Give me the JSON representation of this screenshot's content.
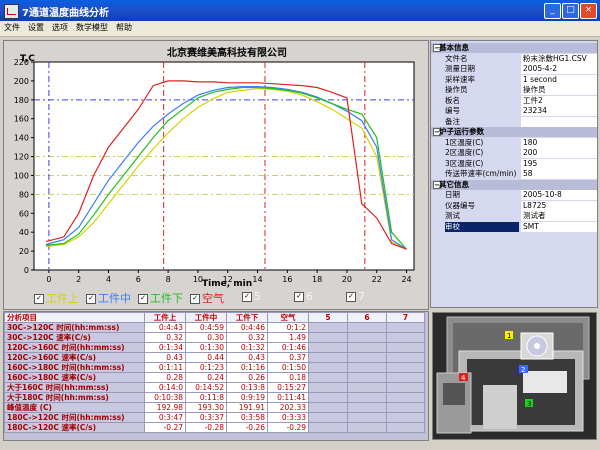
{
  "window": {
    "title": "7通道温度曲线分析"
  },
  "menu": [
    "文件",
    "设置",
    "选项",
    "数学模型",
    "帮助"
  ],
  "chart": {
    "title": "北京赛维美高科技有限公司",
    "ylabel": "T,C",
    "xlabel": "Time, min",
    "xticks": [
      "0",
      "2",
      "4",
      "6",
      "8",
      "10",
      "12",
      "14",
      "16",
      "18",
      "20",
      "22",
      "24"
    ],
    "yticks": [
      "0",
      "20",
      "40",
      "60",
      "80",
      "100",
      "120",
      "140",
      "160",
      "180",
      "200",
      "220"
    ]
  },
  "chart_data": {
    "type": "line",
    "title": "北京赛维美高科技有限公司",
    "xlabel": "Time, min",
    "ylabel": "T,C",
    "xlim": [
      -1,
      24.5
    ],
    "ylim": [
      0,
      220
    ],
    "grid": false,
    "reference_lines": {
      "horizontal": [
        80,
        100,
        120,
        180
      ],
      "vertical": [
        0,
        7.7,
        14.5,
        21.2
      ]
    },
    "series": [
      {
        "name": "工件上",
        "color": "#d4d400",
        "x": [
          -0.2,
          1,
          2,
          3,
          4,
          5,
          6,
          7,
          8,
          9,
          10,
          11,
          12,
          13,
          14,
          15,
          16,
          17,
          18,
          19,
          20,
          21,
          22,
          23,
          24
        ],
        "y": [
          25,
          27,
          35,
          50,
          70,
          90,
          110,
          128,
          145,
          160,
          172,
          181,
          188,
          190,
          192,
          191,
          189,
          185,
          178,
          170,
          160,
          150,
          120,
          30,
          22
        ]
      },
      {
        "name": "工件中",
        "color": "#3c7cff",
        "x": [
          -0.2,
          1,
          2,
          3,
          4,
          5,
          6,
          7,
          8,
          9,
          10,
          11,
          12,
          13,
          14,
          15,
          16,
          17,
          18,
          19,
          20,
          21,
          22,
          23,
          24
        ],
        "y": [
          27,
          32,
          45,
          70,
          95,
          115,
          135,
          152,
          165,
          176,
          185,
          190,
          193,
          194,
          194,
          193,
          191,
          188,
          183,
          176,
          168,
          158,
          130,
          32,
          22
        ]
      },
      {
        "name": "工件下",
        "color": "#20c020",
        "x": [
          -0.2,
          1,
          2,
          3,
          4,
          5,
          6,
          7,
          8,
          9,
          10,
          11,
          12,
          13,
          14,
          15,
          16,
          17,
          18,
          19,
          20,
          21,
          22,
          23,
          24
        ],
        "y": [
          26,
          28,
          38,
          58,
          80,
          100,
          120,
          140,
          158,
          170,
          182,
          188,
          191,
          193,
          193,
          192,
          190,
          187,
          182,
          176,
          170,
          165,
          140,
          40,
          22
        ]
      },
      {
        "name": "空气",
        "color": "#e02020",
        "x": [
          -0.2,
          1,
          2,
          3,
          4,
          5,
          6,
          7,
          8,
          9,
          10,
          11,
          12,
          13,
          14,
          15,
          16,
          17,
          18,
          19,
          20,
          21,
          22,
          23,
          24
        ],
        "y": [
          30,
          35,
          60,
          100,
          130,
          150,
          170,
          195,
          200,
          200,
          199,
          199,
          198,
          198,
          198,
          197,
          196,
          195,
          193,
          188,
          182,
          70,
          55,
          28,
          22
        ]
      }
    ],
    "inactive_series": [
      "5",
      "6",
      "7"
    ]
  },
  "table": {
    "headers": [
      "分析项目",
      "工件上",
      "工件中",
      "工件下",
      "空气",
      "5",
      "6",
      "7"
    ],
    "rows": [
      {
        "label": "30C->120C 时间(hh:mm:ss)",
        "values": [
          "0:4:43",
          "0:4:59",
          "0:4:46",
          "0:1:2"
        ]
      },
      {
        "label": "30C->120C 速率(C/s)",
        "values": [
          "0.32",
          "0.30",
          "0.32",
          "1.49"
        ]
      },
      {
        "label": "120C->160C 时间(hh:mm:ss)",
        "values": [
          "0:1:34",
          "0:1:30",
          "0:1:32",
          "0:1:46"
        ]
      },
      {
        "label": "120C->160C 速率(C/s)",
        "values": [
          "0.43",
          "0.44",
          "0.43",
          "0.37"
        ]
      },
      {
        "label": "160C->180C 时间(hh:mm:ss)",
        "values": [
          "0:1:11",
          "0:1:23",
          "0:1:16",
          "0:1:50"
        ]
      },
      {
        "label": "160C->180C 速率(C/s)",
        "values": [
          "0.28",
          "0.24",
          "0.26",
          "0.18"
        ]
      },
      {
        "label": "大于160C 时间(hh:mm:ss)",
        "values": [
          "0:14:0",
          "0:14:52",
          "0:13:8",
          "0:15:27"
        ]
      },
      {
        "label": "大于180C 时间(hh:mm:ss)",
        "values": [
          "0:10:38",
          "0:11:8",
          "0:9:19",
          "0:11:41"
        ]
      },
      {
        "label": "峰值温度 (C)",
        "values": [
          "192.98",
          "193.30",
          "191.91",
          "202.33"
        ]
      },
      {
        "label": "180C->120C 时间(hh:mm:ss)",
        "values": [
          "0:3:47",
          "0:3:37",
          "0:3:58",
          "0:3:33"
        ]
      },
      {
        "label": "180C->120C 速率(C/s)",
        "values": [
          "-0.27",
          "-0.28",
          "-0.26",
          "-0.29"
        ]
      }
    ]
  },
  "props": [
    {
      "category": "基本信息"
    },
    {
      "k": "文件名",
      "v": "粉末涂敷HG1.CSV"
    },
    {
      "k": "测量日期",
      "v": "2005-4-2"
    },
    {
      "k": "采样速率",
      "v": "1 second"
    },
    {
      "k": "操作员",
      "v": "操作员"
    },
    {
      "k": "板名",
      "v": "工件2"
    },
    {
      "k": "编号",
      "v": "23234"
    },
    {
      "k": "备注",
      "v": ""
    },
    {
      "category": "炉子运行参数"
    },
    {
      "k": "1区温度(C)",
      "v": "180"
    },
    {
      "k": "2区温度(C)",
      "v": "200"
    },
    {
      "k": "3区温度(C)",
      "v": "195"
    },
    {
      "k": "传送带速率(cm/min)",
      "v": "58"
    },
    {
      "category": "其它信息"
    },
    {
      "k": "日期",
      "v": "2005-10-8"
    },
    {
      "k": "仪器编号",
      "v": "L8725"
    },
    {
      "k": "测试",
      "v": "测试者"
    },
    {
      "k": "审校",
      "v": "SMT",
      "selected": true
    }
  ],
  "photo_labels": [
    "1",
    "2",
    "3",
    "4"
  ],
  "colors": {
    "axis_bg": "#ffffff",
    "plot_bg": "#d6d3d0",
    "header_red": "#c00000",
    "selection": "#0a246a"
  }
}
